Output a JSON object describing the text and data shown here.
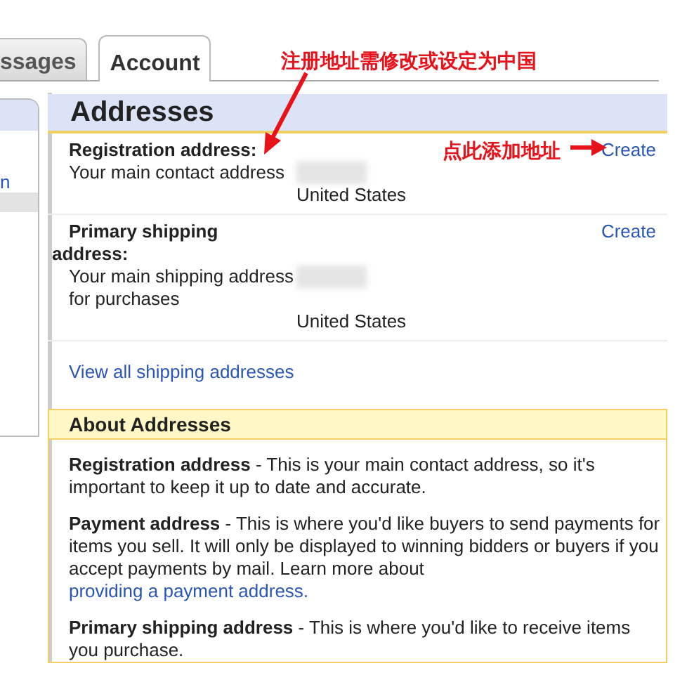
{
  "tabs": [
    {
      "label": "ssages",
      "selected": false
    },
    {
      "label": "Account",
      "selected": true
    }
  ],
  "sidebar": {
    "items": [
      {
        "label": "n",
        "selected": false
      },
      {
        "selected": true
      }
    ]
  },
  "addresses": {
    "title": "Addresses",
    "entries": [
      {
        "label": "Registration address:",
        "description": "Your main contact address",
        "country": "United States",
        "action": "Create"
      },
      {
        "label": "Primary shipping address:",
        "description": "Your main shipping address for purchases",
        "country": "United States",
        "action": "Create"
      }
    ],
    "view_all_link": "View all shipping addresses"
  },
  "about": {
    "title": "About Addresses",
    "paragraphs": [
      {
        "text": "**Registration address** - This is your main contact address, so it's important to keep it up to date and accurate."
      },
      {
        "text": "**Payment address** - This is where you'd like buyers to send payments for items you sell. It will only be displayed to winning bidders or buyers if you accept payments by mail. Learn more about",
        "link": "providing a payment address."
      },
      {
        "text": "**Primary shipping address** - This is where you'd like to receive items you purchase."
      }
    ]
  },
  "annotations": [
    {
      "kind": "note",
      "text": "注册地址需修改或设定为中国"
    },
    {
      "kind": "note",
      "text": "点此添加地址"
    }
  ]
}
